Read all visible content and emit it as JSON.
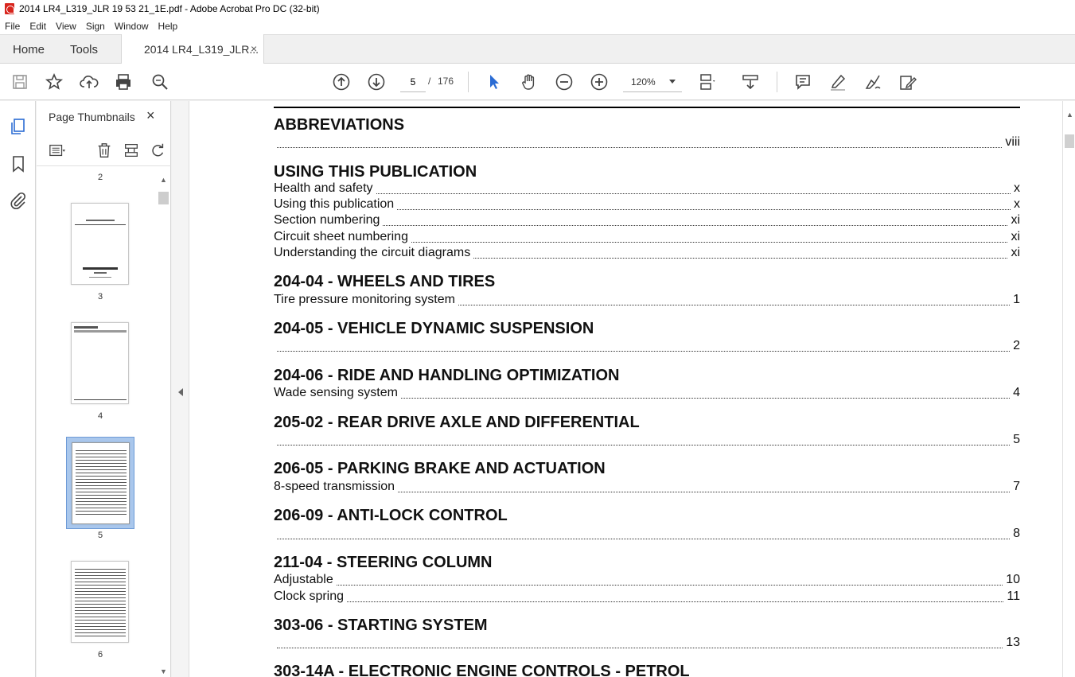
{
  "window": {
    "title": "2014 LR4_L319_JLR 19 53 21_1E.pdf - Adobe Acrobat Pro DC (32-bit)"
  },
  "menu": [
    "File",
    "Edit",
    "View",
    "Sign",
    "Window",
    "Help"
  ],
  "tabs": {
    "home": "Home",
    "tools": "Tools",
    "doc": "2014 LR4_L319_JLR...",
    "close": "×"
  },
  "toolbar": {
    "page_current": "5",
    "page_sep": "/",
    "page_total": "176",
    "zoom": "120%"
  },
  "thumbnails": {
    "title": "Page Thumbnails",
    "close": "×",
    "pages": [
      "2",
      "3",
      "4",
      "5",
      "6"
    ],
    "selected": "5"
  },
  "toc": [
    {
      "heading": "ABBREVIATIONS",
      "entries": [
        {
          "text": "",
          "page": "viii"
        }
      ]
    },
    {
      "heading": "USING THIS PUBLICATION",
      "entries": [
        {
          "text": "Health and safety",
          "page": "x"
        },
        {
          "text": "Using this publication",
          "page": "x"
        },
        {
          "text": "Section numbering",
          "page": "xi"
        },
        {
          "text": "Circuit sheet numbering",
          "page": "xi"
        },
        {
          "text": "Understanding the circuit diagrams",
          "page": "xi"
        }
      ]
    },
    {
      "heading": "204-04 - WHEELS AND TIRES",
      "entries": [
        {
          "text": "Tire pressure monitoring system",
          "page": "1"
        }
      ]
    },
    {
      "heading": "204-05 - VEHICLE DYNAMIC SUSPENSION",
      "entries": [
        {
          "text": "",
          "page": "2"
        }
      ]
    },
    {
      "heading": "204-06 - RIDE AND HANDLING OPTIMIZATION",
      "entries": [
        {
          "text": "Wade sensing system",
          "page": "4"
        }
      ]
    },
    {
      "heading": "205-02 - REAR DRIVE AXLE AND DIFFERENTIAL",
      "entries": [
        {
          "text": "",
          "page": "5"
        }
      ]
    },
    {
      "heading": "206-05 - PARKING BRAKE AND ACTUATION",
      "entries": [
        {
          "text": "8-speed transmission",
          "page": "7"
        }
      ]
    },
    {
      "heading": "206-09 - ANTI-LOCK CONTROL",
      "entries": [
        {
          "text": "",
          "page": "8"
        }
      ]
    },
    {
      "heading": "211-04 - STEERING COLUMN",
      "entries": [
        {
          "text": "Adjustable",
          "page": "10"
        },
        {
          "text": "Clock spring",
          "page": "11"
        }
      ]
    },
    {
      "heading": "303-06 - STARTING SYSTEM",
      "entries": [
        {
          "text": "",
          "page": "13"
        }
      ]
    },
    {
      "heading": "303-14A - ELECTRONIC ENGINE CONTROLS - PETROL",
      "entries": []
    }
  ]
}
